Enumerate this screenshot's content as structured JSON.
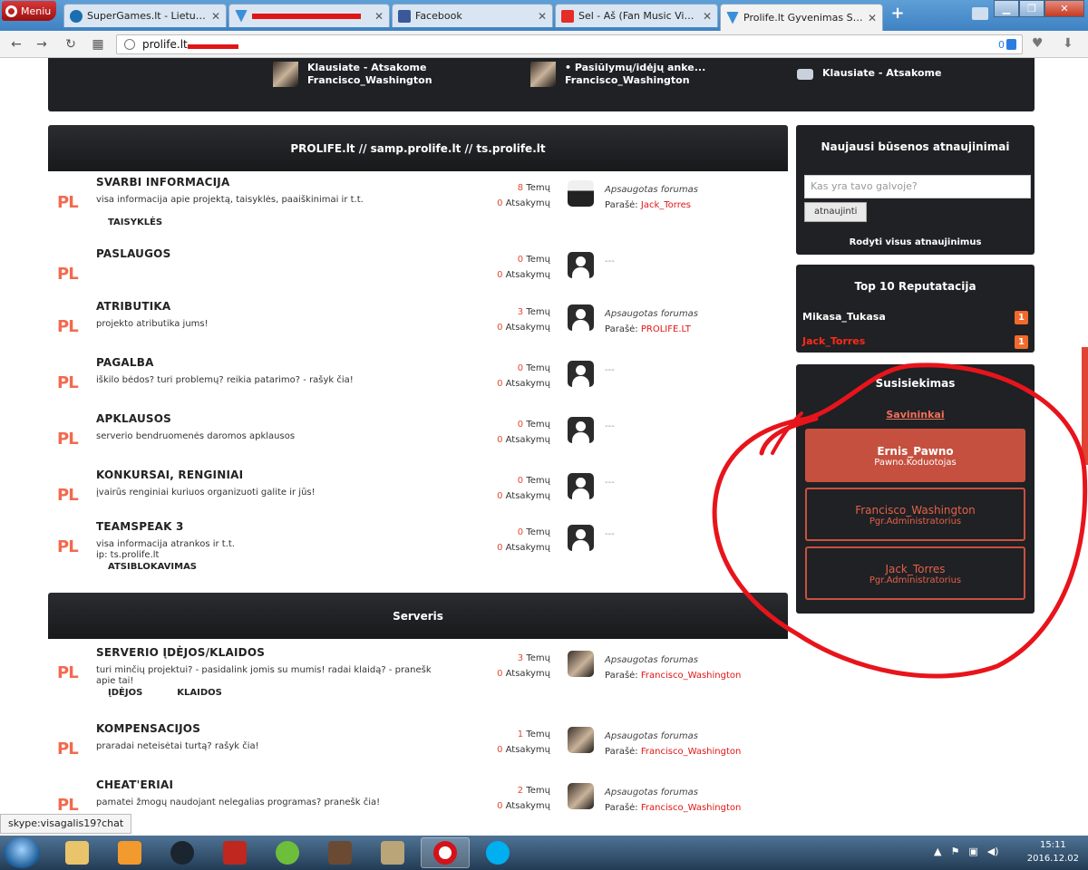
{
  "browser": {
    "menu_label": "Meniu",
    "tabs": [
      {
        "label": "SuperGames.lt - Lietuviai ž",
        "icon": "supergames-favicon"
      },
      {
        "label": "",
        "icon": "prolife-favicon"
      },
      {
        "label": "Facebook",
        "icon": "facebook-favicon"
      },
      {
        "label": "Sel - Aš (Fan Music Video)",
        "icon": "youtube-favicon"
      },
      {
        "label": "Prolife.lt Gyvenimas San An",
        "icon": "prolife-favicon"
      }
    ],
    "new_tab_label": "+",
    "address": "prolife.lt",
    "adblock_count": "0",
    "status_url": "skype:visagalis19?chat"
  },
  "top_strip": [
    {
      "line1": "Klausiate - Atsakome",
      "line2": "Francisco_Washington",
      "icon": "avatar"
    },
    {
      "line1": "• Pasiūlymų/idėjų anke...",
      "line2": "Francisco_Washington",
      "icon": "avatar"
    },
    {
      "line1": "Klausiate - Atsakome",
      "line2": "",
      "icon": "chat-bubble-icon"
    }
  ],
  "categories": [
    {
      "title": "PROLIFE.lt // samp.prolife.lt // ts.prolife.lt"
    },
    {
      "title": "Serveris"
    }
  ],
  "forums": [
    {
      "title": "SVARBI INFORMACIJA",
      "desc": "visa informacija apie projektą, taisyklės, paaiškinimai ir t.t.",
      "subs": [
        "TAISYKLĖS"
      ],
      "topics": "8",
      "topics_label": "Temų",
      "replies": "0",
      "replies_label": "Atsakymų",
      "last_title": "Apsaugotas forumas",
      "by_label": "Parašė:",
      "last_user": "Jack_Torres",
      "avatar": "cat"
    },
    {
      "title": "PASLAUGOS",
      "desc": "",
      "subs": [],
      "topics": "0",
      "topics_label": "Temų",
      "replies": "0",
      "replies_label": "Atsakymų",
      "last_title": "---",
      "by_label": "",
      "last_user": "",
      "avatar": "empty"
    },
    {
      "title": "ATRIBUTIKA",
      "desc": "projekto atributika jums!",
      "subs": [],
      "topics": "3",
      "topics_label": "Temų",
      "replies": "0",
      "replies_label": "Atsakymų",
      "last_title": "Apsaugotas forumas",
      "by_label": "Parašė:",
      "last_user": "PROLIFE.LT",
      "avatar": "empty"
    },
    {
      "title": "PAGALBA",
      "desc": "iškilo bėdos? turi problemų? reikia patarimo? - rašyk čia!",
      "subs": [],
      "topics": "0",
      "topics_label": "Temų",
      "replies": "0",
      "replies_label": "Atsakymų",
      "last_title": "---",
      "by_label": "",
      "last_user": "",
      "avatar": "empty"
    },
    {
      "title": "APKLAUSOS",
      "desc": "serverio bendruomenės daromos apklausos",
      "subs": [],
      "topics": "0",
      "topics_label": "Temų",
      "replies": "0",
      "replies_label": "Atsakymų",
      "last_title": "---",
      "by_label": "",
      "last_user": "",
      "avatar": "empty"
    },
    {
      "title": "KONKURSAI, RENGINIAI",
      "desc": "įvairūs renginiai kuriuos organizuoti galite ir jūs!",
      "subs": [],
      "topics": "0",
      "topics_label": "Temų",
      "replies": "0",
      "replies_label": "Atsakymų",
      "last_title": "---",
      "by_label": "",
      "last_user": "",
      "avatar": "empty"
    },
    {
      "title": "TEAMSPEAK 3",
      "desc": "visa informacija atrankos ir t.t.\nip: ts.prolife.lt",
      "subs": [
        "ATSIBLOKAVIMAS"
      ],
      "topics": "0",
      "topics_label": "Temų",
      "replies": "0",
      "replies_label": "Atsakymų",
      "last_title": "---",
      "by_label": "",
      "last_user": "",
      "avatar": "empty"
    },
    {
      "title": "SERVERIO ĮDĖJOS/KLAIDOS",
      "desc": "turi minčių projektui? - pasidalink jomis su mumis! radai klaidą? - pranešk apie tai!",
      "subs": [
        "ĮDĖJOS",
        "KLAIDOS"
      ],
      "topics": "3",
      "topics_label": "Temų",
      "replies": "0",
      "replies_label": "Atsakymų",
      "last_title": "Apsaugotas forumas",
      "by_label": "Parašė:",
      "last_user": "Francisco_Washington",
      "avatar": "man"
    },
    {
      "title": "KOMPENSACIJOS",
      "desc": "praradai neteisėtai turtą? rašyk čia!",
      "subs": [],
      "topics": "1",
      "topics_label": "Temų",
      "replies": "0",
      "replies_label": "Atsakymų",
      "last_title": "Apsaugotas forumas",
      "by_label": "Parašė:",
      "last_user": "Francisco_Washington",
      "avatar": "man"
    },
    {
      "title": "CHEAT'ERIAI",
      "desc": "pamatei žmogų naudojant nelegalias programas? pranešk čia!",
      "subs": [],
      "topics": "2",
      "topics_label": "Temų",
      "replies": "0",
      "replies_label": "Atsakymų",
      "last_title": "Apsaugotas forumas",
      "by_label": "Parašė:",
      "last_user": "Francisco_Washington",
      "avatar": "man"
    }
  ],
  "logo_text": "PL",
  "sidebar": {
    "status": {
      "title": "Naujausi būsenos atnaujinimai",
      "placeholder": "Kas yra tavo galvoje?",
      "button": "atnaujinti",
      "show_all": "Rodyti visus atnaujinimus"
    },
    "reputation": {
      "title": "Top 10 Reputatacija",
      "rows": [
        {
          "name": "Mikasa_Tukasa",
          "score": "1",
          "color": "#ffffff"
        },
        {
          "name": "Jack_Torres",
          "score": "1",
          "color": "#ff2a1a"
        }
      ]
    },
    "contact": {
      "title": "Susisiekimas",
      "subtitle": "Savininkai",
      "people": [
        {
          "name": "Ernis_Pawno",
          "role": "Pawno.Koduotojas",
          "style": "primary"
        },
        {
          "name": "Francisco_Washington",
          "role": "Pgr.Administratorius",
          "style": "outline"
        },
        {
          "name": "Jack_Torres",
          "role": "Pgr.Administratorius",
          "style": "outline"
        }
      ]
    }
  },
  "taskbar": {
    "time": "15:11",
    "date": "2016.12.02",
    "apps": [
      "explorer",
      "media-player",
      "winamp",
      "filezilla",
      "utorrent",
      "game",
      "app",
      "opera",
      "skype"
    ]
  },
  "colors": {
    "accent": "#e04b32",
    "dark_panel": "#1f2124",
    "annotation": "#e8141b"
  }
}
